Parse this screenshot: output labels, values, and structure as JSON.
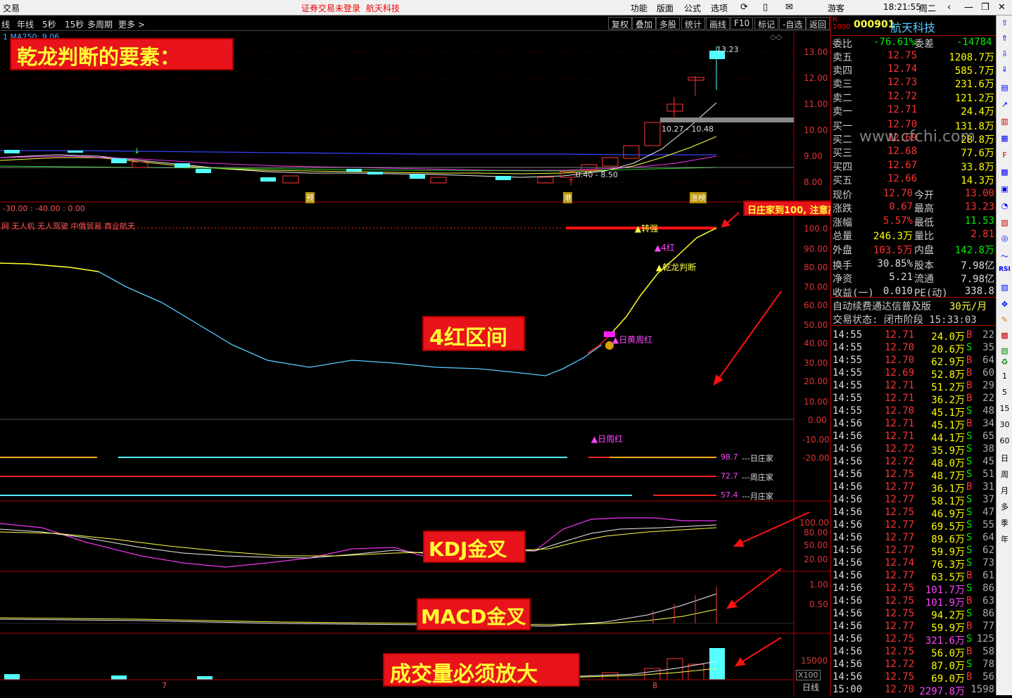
{
  "titlebar": {
    "app": "交易",
    "notice": "证券交易未登录",
    "stock": "航天科技",
    "menus": [
      "功能",
      "版面",
      "公式",
      "选项"
    ],
    "user": "游客",
    "time": "18:21:55",
    "weekday": "周二"
  },
  "toolbar": {
    "periods": [
      "线",
      "年线",
      "5秒",
      "15秒",
      "多周期",
      "更多 >"
    ],
    "buttons": [
      "复权",
      "叠加",
      "多股",
      "统计",
      "画线",
      "F10",
      "标记",
      "-自选",
      "返回"
    ]
  },
  "chart_header": {
    "ma_line": "1 MA250: 9.06",
    "ind_params": "-30.00 : -40.00 : 0.00",
    "concepts": "网 无人机 无人驾驶 中俄贸易 商业航天"
  },
  "price_axis": [
    "13.00",
    "12.00",
    "11.00",
    "10.00",
    "9.00",
    "8.00"
  ],
  "ind_axis": [
    "100.0",
    "90.00",
    "80.00",
    "70.00",
    "60.00",
    "50.00",
    "40.00",
    "30.00",
    "20.00",
    "10.00",
    "0.00",
    "-10.00",
    "-20.00"
  ],
  "kdj_axis": [
    "100.00",
    "80.00",
    "50.00",
    "20.00"
  ],
  "macd_axis": [
    "1.00",
    "0.50"
  ],
  "vol_axis": [
    "15000"
  ],
  "vol_unit": "X100",
  "period_label": "日线",
  "price_labels": {
    "high": "13.23",
    "box": "10.27 - 10.48",
    "low": "8.40 - 8.50"
  },
  "event_labels": {
    "yu": "预",
    "gang": "港",
    "zhangbang": "涨榜"
  },
  "signals": {
    "zhuanqiang": "▲转强",
    "sihong": "▲4红",
    "qianlong": "▲乾龙判断",
    "rihuang": "▲日黄周红",
    "rizhou": "▲日周红"
  },
  "zhuangjia": [
    {
      "val": "98.7",
      "name": "---日庄家"
    },
    {
      "val": "72.7",
      "name": "---周庄家"
    },
    {
      "val": "57.4",
      "name": "---月庄家"
    }
  ],
  "annotations": {
    "title": "乾龙判断的要素：",
    "sihong": "4红区间",
    "kdj": "KDJ金叉",
    "macd": "MACD金叉",
    "vol": "成交量必须放大",
    "warning": "日庄家到100, 注意高抛"
  },
  "watermark": "www.cfchi.com",
  "date_marks": [
    "7",
    "8"
  ],
  "quote": {
    "code": "000901",
    "name": "航天科技",
    "weibi_label": "委比",
    "weibi": "-76.61%",
    "weicha_label": "委差",
    "weicha": "-14784",
    "asks": [
      {
        "label": "卖五",
        "price": "12.75",
        "vol": "1208.7万"
      },
      {
        "label": "卖四",
        "price": "12.74",
        "vol": "585.7万"
      },
      {
        "label": "卖三",
        "price": "12.73",
        "vol": "231.6万"
      },
      {
        "label": "卖二",
        "price": "12.72",
        "vol": "121.2万"
      },
      {
        "label": "卖一",
        "price": "12.71",
        "vol": "24.4万"
      }
    ],
    "bids": [
      {
        "label": "买一",
        "price": "12.70",
        "vol": "131.8万"
      },
      {
        "label": "买二",
        "price": "12.69",
        "vol": "28.8万"
      },
      {
        "label": "买三",
        "price": "12.68",
        "vol": "77.6万"
      },
      {
        "label": "买四",
        "price": "12.67",
        "vol": "33.8万"
      },
      {
        "label": "买五",
        "price": "12.66",
        "vol": "14.3万"
      }
    ],
    "stats": [
      {
        "l1": "现价",
        "v1": "12.70",
        "c1": "red",
        "l2": "今开",
        "v2": "13.00",
        "c2": "red"
      },
      {
        "l1": "涨跌",
        "v1": "0.67",
        "c1": "red",
        "l2": "最高",
        "v2": "13.23",
        "c2": "red"
      },
      {
        "l1": "涨幅",
        "v1": "5.57%",
        "c1": "red",
        "l2": "最低",
        "v2": "11.53",
        "c2": "grn"
      },
      {
        "l1": "总量",
        "v1": "246.3万",
        "c1": "yel",
        "l2": "量比",
        "v2": "2.81",
        "c2": "red"
      },
      {
        "l1": "外盘",
        "v1": "103.5万",
        "c1": "red",
        "l2": "内盘",
        "v2": "142.8万",
        "c2": "grn"
      },
      {
        "l1": "换手",
        "v1": "30.85%",
        "c1": "wht",
        "l2": "股本",
        "v2": "7.98亿",
        "c2": "wht"
      },
      {
        "l1": "净资",
        "v1": "5.21",
        "c1": "wht",
        "l2": "流通",
        "v2": "7.98亿",
        "c2": "wht"
      },
      {
        "l1": "收益(一)",
        "v1": "0.010",
        "c1": "wht",
        "l2": "PE(动)",
        "v2": "338.8",
        "c2": "wht"
      }
    ],
    "promo": "自动续费通达信普及版",
    "promo_price": "30元/月",
    "status": "交易状态: 闭市阶段 15:33:03",
    "ticks": [
      [
        "14:55",
        "12.71",
        "24.0万",
        "B",
        "22"
      ],
      [
        "14:55",
        "12.70",
        "20.6万",
        "S",
        "35"
      ],
      [
        "14:55",
        "12.70",
        "62.9万",
        "B",
        "64"
      ],
      [
        "14:55",
        "12.69",
        "52.8万",
        "B",
        "60"
      ],
      [
        "14:55",
        "12.71",
        "51.2万",
        "B",
        "29"
      ],
      [
        "14:55",
        "12.71",
        "36.2万",
        "B",
        "22"
      ],
      [
        "14:55",
        "12.70",
        "45.1万",
        "S",
        "48"
      ],
      [
        "14:56",
        "12.71",
        "45.1万",
        "B",
        "34"
      ],
      [
        "14:56",
        "12.71",
        "44.1万",
        "S",
        "65"
      ],
      [
        "14:56",
        "12.72",
        "35.9万",
        "S",
        "38"
      ],
      [
        "14:56",
        "12.72",
        "48.0万",
        "S",
        "45"
      ],
      [
        "14:56",
        "12.75",
        "48.7万",
        "S",
        "51"
      ],
      [
        "14:56",
        "12.77",
        "36.1万",
        "B",
        "31"
      ],
      [
        "14:56",
        "12.77",
        "58.1万",
        "S",
        "37"
      ],
      [
        "14:56",
        "12.75",
        "46.9万",
        "S",
        "47"
      ],
      [
        "14:56",
        "12.77",
        "69.5万",
        "S",
        "55"
      ],
      [
        "14:56",
        "12.77",
        "89.6万",
        "S",
        "64"
      ],
      [
        "14:56",
        "12.77",
        "59.9万",
        "S",
        "62"
      ],
      [
        "14:56",
        "12.74",
        "76.3万",
        "S",
        "73"
      ],
      [
        "14:56",
        "12.77",
        "63.5万",
        "B",
        "61"
      ],
      [
        "14:56",
        "12.75",
        "101.7万",
        "S",
        "86"
      ],
      [
        "14:56",
        "12.75",
        "101.9万",
        "B",
        "63"
      ],
      [
        "14:56",
        "12.75",
        "94.2万",
        "S",
        "86"
      ],
      [
        "14:56",
        "12.77",
        "59.9万",
        "B",
        "77"
      ],
      [
        "14:56",
        "12.75",
        "321.6万",
        "S",
        "125"
      ],
      [
        "14:56",
        "12.75",
        "56.0万",
        "B",
        "58"
      ],
      [
        "14:56",
        "12.72",
        "87.0万",
        "S",
        "78"
      ],
      [
        "14:56",
        "12.75",
        "69.0万",
        "B",
        "56"
      ],
      [
        "15:00",
        "12.70",
        "2297.8万",
        "",
        "1598"
      ]
    ]
  },
  "sidebar_items": [
    "1",
    "5",
    "15",
    "30",
    "60",
    "日",
    "周",
    "月",
    "多",
    "季",
    "年"
  ]
}
